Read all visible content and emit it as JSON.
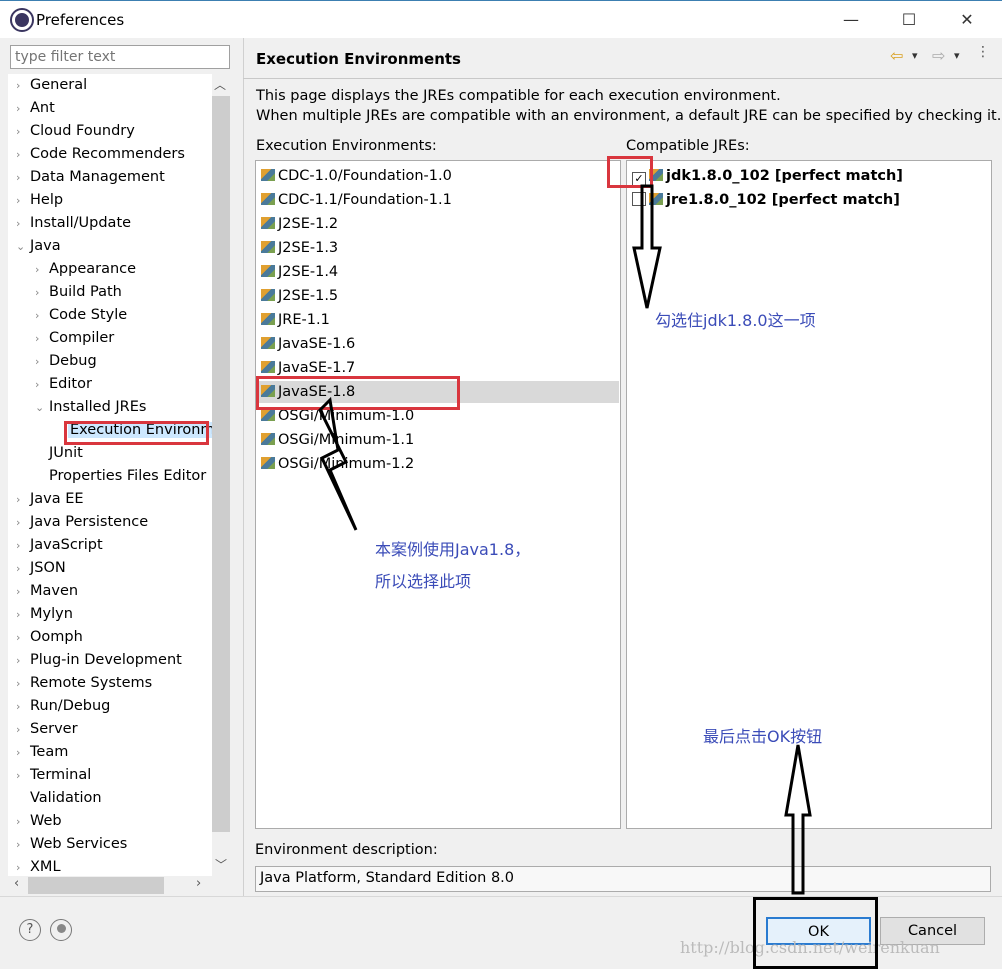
{
  "window": {
    "title": "Preferences",
    "minimize": "—",
    "maximize": "☐",
    "close": "✕"
  },
  "filter": {
    "placeholder": "type filter text"
  },
  "tree": [
    {
      "label": "General",
      "level": 0,
      "arrow": "›"
    },
    {
      "label": "Ant",
      "level": 0,
      "arrow": "›"
    },
    {
      "label": "Cloud Foundry",
      "level": 0,
      "arrow": "›"
    },
    {
      "label": "Code Recommenders",
      "level": 0,
      "arrow": "›"
    },
    {
      "label": "Data Management",
      "level": 0,
      "arrow": "›"
    },
    {
      "label": "Help",
      "level": 0,
      "arrow": "›"
    },
    {
      "label": "Install/Update",
      "level": 0,
      "arrow": "›"
    },
    {
      "label": "Java",
      "level": 0,
      "arrow": "⌄"
    },
    {
      "label": "Appearance",
      "level": 1,
      "arrow": "›"
    },
    {
      "label": "Build Path",
      "level": 1,
      "arrow": "›"
    },
    {
      "label": "Code Style",
      "level": 1,
      "arrow": "›"
    },
    {
      "label": "Compiler",
      "level": 1,
      "arrow": "›"
    },
    {
      "label": "Debug",
      "level": 1,
      "arrow": "›"
    },
    {
      "label": "Editor",
      "level": 1,
      "arrow": "›"
    },
    {
      "label": "Installed JREs",
      "level": 1,
      "arrow": "⌄"
    },
    {
      "label": "Execution Environments",
      "level": 2,
      "arrow": "",
      "selected": true
    },
    {
      "label": "JUnit",
      "level": 1,
      "arrow": ""
    },
    {
      "label": "Properties Files Editor",
      "level": 1,
      "arrow": ""
    },
    {
      "label": "Java EE",
      "level": 0,
      "arrow": "›"
    },
    {
      "label": "Java Persistence",
      "level": 0,
      "arrow": "›"
    },
    {
      "label": "JavaScript",
      "level": 0,
      "arrow": "›"
    },
    {
      "label": "JSON",
      "level": 0,
      "arrow": "›"
    },
    {
      "label": "Maven",
      "level": 0,
      "arrow": "›"
    },
    {
      "label": "Mylyn",
      "level": 0,
      "arrow": "›"
    },
    {
      "label": "Oomph",
      "level": 0,
      "arrow": "›"
    },
    {
      "label": "Plug-in Development",
      "level": 0,
      "arrow": "›"
    },
    {
      "label": "Remote Systems",
      "level": 0,
      "arrow": "›"
    },
    {
      "label": "Run/Debug",
      "level": 0,
      "arrow": "›"
    },
    {
      "label": "Server",
      "level": 0,
      "arrow": "›"
    },
    {
      "label": "Team",
      "level": 0,
      "arrow": "›"
    },
    {
      "label": "Terminal",
      "level": 0,
      "arrow": "›"
    },
    {
      "label": "Validation",
      "level": 0,
      "arrow": ""
    },
    {
      "label": "Web",
      "level": 0,
      "arrow": "›"
    },
    {
      "label": "Web Services",
      "level": 0,
      "arrow": "›"
    },
    {
      "label": "XML",
      "level": 0,
      "arrow": "›"
    }
  ],
  "page": {
    "title": "Execution Environments",
    "nav": {
      "back": "⇦",
      "forward": "⇨",
      "dropdown": "▾"
    },
    "description_1": "This page displays the JREs compatible for each execution environment.",
    "description_2": "When multiple JREs are compatible with an environment, a default JRE can be specified by checking it.",
    "env_label": "Execution Environments:",
    "jre_label": "Compatible JREs:",
    "environments": [
      "CDC-1.0/Foundation-1.0",
      "CDC-1.1/Foundation-1.1",
      "J2SE-1.2",
      "J2SE-1.3",
      "J2SE-1.4",
      "J2SE-1.5",
      "JRE-1.1",
      "JavaSE-1.6",
      "JavaSE-1.7",
      "JavaSE-1.8",
      "OSGi/Minimum-1.0",
      "OSGi/Minimum-1.1",
      "OSGi/Minimum-1.2"
    ],
    "selected_environment": "JavaSE-1.8",
    "jres": [
      {
        "label": "jdk1.8.0_102 [perfect match]",
        "checked": true
      },
      {
        "label": "jre1.8.0_102 [perfect match]",
        "checked": false
      }
    ],
    "env_desc_label": "Environment description:",
    "env_desc_value": "Java Platform, Standard Edition 8.0"
  },
  "buttons": {
    "ok": "OK",
    "cancel": "Cancel",
    "help": "?"
  },
  "annotations": {
    "check_note": "勾选住jdk1.8.0这一项",
    "java_note_1": "本案例使用Java1.8，",
    "java_note_2": "所以选择此项",
    "ok_note": "最后点击OK按钮",
    "color": "#3b4cb8",
    "box_color": "#d9363e"
  },
  "watermark": "http://blog.csdn.net/weirenkuan"
}
